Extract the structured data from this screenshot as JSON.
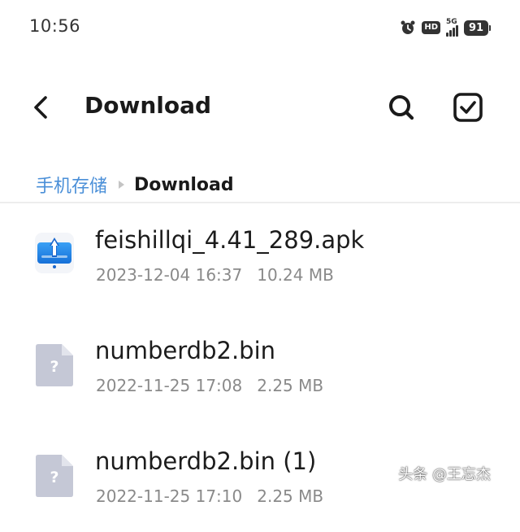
{
  "status_bar": {
    "time": "10:56",
    "network": "5G",
    "hd": "HD",
    "battery": "91",
    "icons": [
      "alarm-icon",
      "hd-icon",
      "signal-5g-icon",
      "battery-icon"
    ]
  },
  "app_bar": {
    "title": "Download",
    "back_icon": "chevron-left-icon",
    "search_icon": "search-icon",
    "select_icon": "checkbox-icon"
  },
  "breadcrumb": {
    "root": "手机存储",
    "current": "Download"
  },
  "files": [
    {
      "name": "feishillqi_4.41_289.apk",
      "date": "2023-12-04 16:37",
      "size": "10.24 MB",
      "icon": "apk-app-icon"
    },
    {
      "name": "numberdb2.bin",
      "date": "2022-11-25 17:08",
      "size": "2.25 MB",
      "icon": "unknown-file-icon"
    },
    {
      "name": "numberdb2.bin (1)",
      "date": "2022-11-25 17:10",
      "size": "2.25 MB",
      "icon": "unknown-file-icon"
    }
  ],
  "watermark": "头条 @王忘杰",
  "colors": {
    "accent": "#4a8fd8",
    "text_primary": "#1a1a1a",
    "text_secondary": "#8a8a8a",
    "file_icon": "#c5c8d6"
  }
}
